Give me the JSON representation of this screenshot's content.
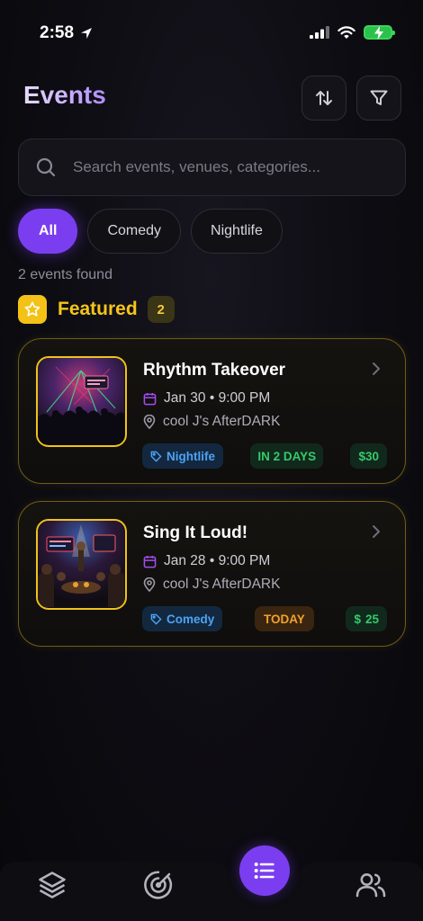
{
  "status_bar": {
    "time": "2:58"
  },
  "header": {
    "title": "Events"
  },
  "search": {
    "placeholder": "Search events, venues, categories..."
  },
  "filters": {
    "chips": [
      {
        "label": "All",
        "active": true
      },
      {
        "label": "Comedy",
        "active": false
      },
      {
        "label": "Nightlife",
        "active": false
      }
    ]
  },
  "results": {
    "count_text": "2 events found"
  },
  "featured": {
    "label": "Featured",
    "count": "2"
  },
  "events": [
    {
      "title": "Rhythm Takeover",
      "date": "Jan 30 • 9:00 PM",
      "venue": "cool J's AfterDARK",
      "category": "Nightlife",
      "timing": "IN 2 DAYS",
      "price": "$30"
    },
    {
      "title": "Sing It Loud!",
      "date": "Jan 28 • 9:00 PM",
      "venue": "cool J's AfterDARK",
      "category": "Comedy",
      "timing": "TODAY",
      "price": "25"
    }
  ],
  "colors": {
    "accent": "#7a3ef0",
    "featured_gold": "#f4c216",
    "category_blue": "#4da3f5",
    "price_green": "#36c96a",
    "today_orange": "#f3a12c"
  },
  "icons": {
    "status": [
      "location-arrow-icon",
      "signal-icon",
      "wifi-icon",
      "battery-charging-icon"
    ],
    "header": [
      "sort-icon",
      "filter-icon"
    ],
    "tab_bar": [
      "layers-icon",
      "radar-icon",
      "list-icon",
      "users-icon"
    ]
  }
}
